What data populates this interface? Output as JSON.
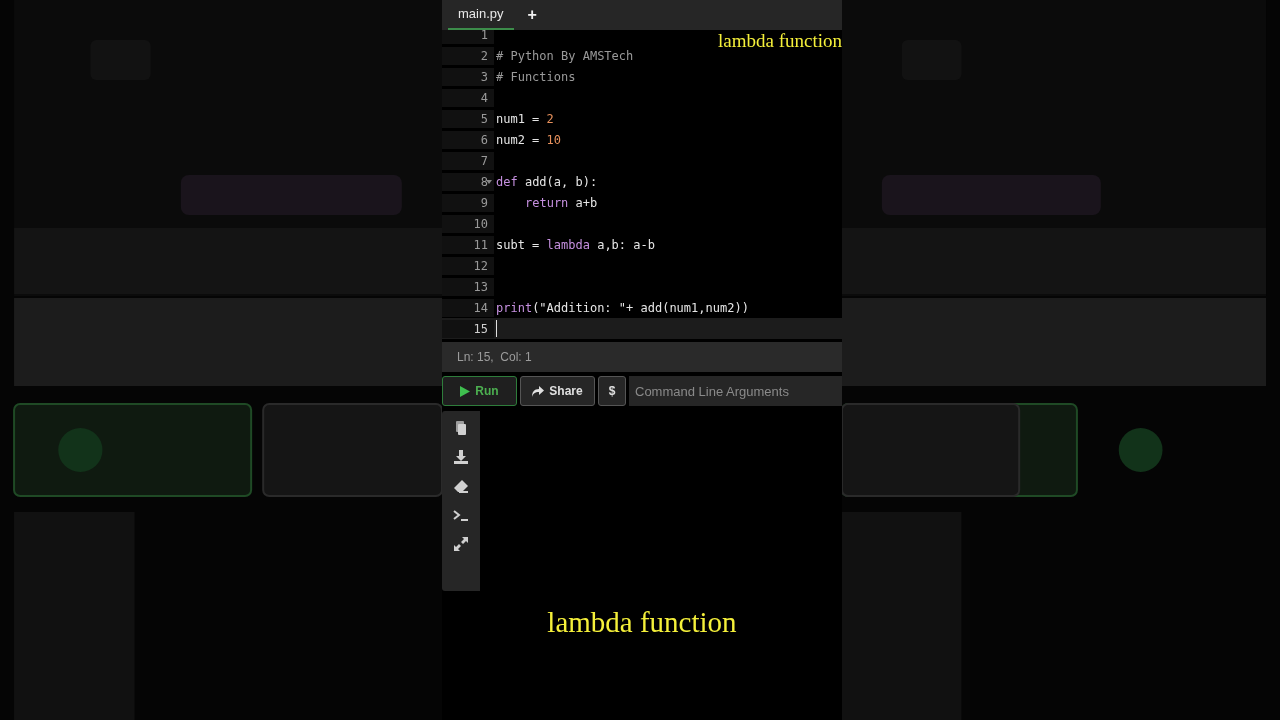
{
  "tabs": [
    {
      "label": "main.py",
      "selected": true
    }
  ],
  "new_tab": "+",
  "overlay_caption": "lambda function",
  "code_lines": [
    {
      "number": "1"
    },
    {
      "number": "2",
      "tokens": [
        {
          "text": "# Python By AMSTech",
          "kind": "comment"
        }
      ]
    },
    {
      "number": "3",
      "tokens": [
        {
          "text": "# Functions",
          "kind": "comment"
        }
      ]
    },
    {
      "number": "4"
    },
    {
      "number": "5",
      "tokens": [
        {
          "text": "num1 = ",
          "kind": "plain"
        },
        {
          "text": "2",
          "kind": "number"
        }
      ]
    },
    {
      "number": "6",
      "tokens": [
        {
          "text": "num2 = ",
          "kind": "plain"
        },
        {
          "text": "10",
          "kind": "number"
        }
      ]
    },
    {
      "number": "7"
    },
    {
      "number": "8",
      "foldable": true,
      "tokens": [
        {
          "text": "def",
          "kind": "keyword"
        },
        {
          "text": " add(a, b):",
          "kind": "plain"
        }
      ],
      "children": [
        {
          "number": "9",
          "tokens": [
            {
              "text": "return",
              "kind": "keyword"
            },
            {
              "text": " a+b",
              "kind": "plain"
            }
          ]
        }
      ]
    },
    {
      "number": "10"
    },
    {
      "number": "11",
      "tokens": [
        {
          "text": "subt = ",
          "kind": "plain"
        },
        {
          "text": "lambda",
          "kind": "keyword"
        },
        {
          "text": " a,b: a-b",
          "kind": "plain"
        }
      ]
    },
    {
      "number": "12"
    },
    {
      "number": "13"
    },
    {
      "number": "14",
      "tokens": [
        {
          "text": "print",
          "kind": "keyword"
        },
        {
          "text": "(\"Addition: \"+ add(num1,num2))",
          "kind": "plain"
        }
      ]
    },
    {
      "number": "15",
      "cursor": true
    }
  ],
  "status_bar": "Ln: 15,  Col: 1",
  "toolbar": {
    "run": "Run",
    "share": "Share",
    "dollar": "$",
    "args_placeholder": "Command Line Arguments"
  },
  "output_tools": [
    {
      "kind": "copy"
    },
    {
      "kind": "download"
    },
    {
      "kind": "erase"
    },
    {
      "kind": "terminal"
    },
    {
      "kind": "expand"
    }
  ],
  "caption": "lambda function"
}
